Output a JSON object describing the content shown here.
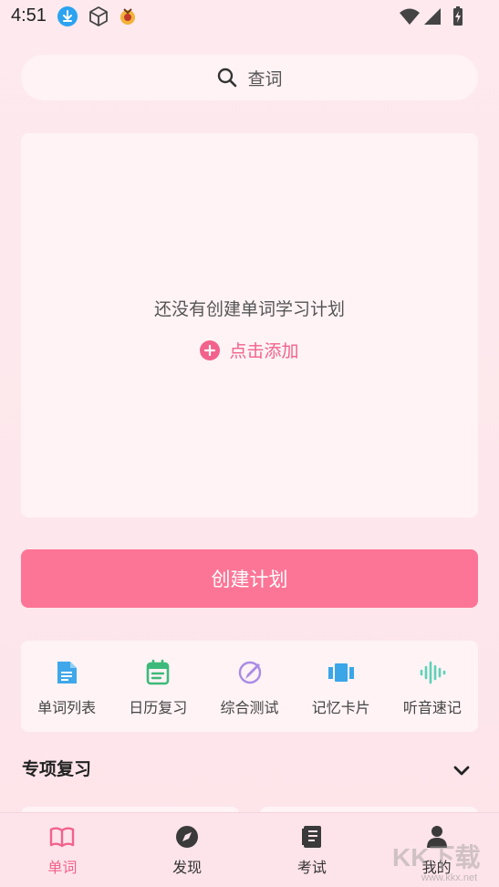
{
  "status_bar": {
    "time": "4:51",
    "icons": [
      "download-icon",
      "box-icon",
      "app-icon",
      "wifi-icon",
      "signal-icon",
      "battery-icon"
    ]
  },
  "search": {
    "placeholder": "查词",
    "icon": "search-icon"
  },
  "plan": {
    "empty_text": "还没有创建单词学习计划",
    "add_label": "点击添加",
    "add_icon": "plus-circle-icon"
  },
  "create_button": {
    "label": "创建计划"
  },
  "features": [
    {
      "label": "单词列表",
      "icon": "document-icon",
      "color": "#3fa7ea"
    },
    {
      "label": "日历复习",
      "icon": "calendar-icon",
      "color": "#3dba7a"
    },
    {
      "label": "综合测试",
      "icon": "test-icon",
      "color": "#a98be6"
    },
    {
      "label": "记忆卡片",
      "icon": "cards-icon",
      "color": "#3aa6e8"
    },
    {
      "label": "听音速记",
      "icon": "audio-wave-icon",
      "color": "#5ed1b8"
    }
  ],
  "special_review": {
    "title": "专项复习",
    "icon": "chevron-down-icon"
  },
  "nav": [
    {
      "label": "单词",
      "icon": "book-icon",
      "active": true
    },
    {
      "label": "发现",
      "icon": "compass-icon",
      "active": false
    },
    {
      "label": "考试",
      "icon": "exam-icon",
      "active": false
    },
    {
      "label": "我的",
      "icon": "user-icon",
      "active": false
    }
  ],
  "colors": {
    "accent": "#fd7596",
    "accent_text": "#f2628c",
    "background": "#fde9ee",
    "card": "#fff3f5"
  },
  "watermark": {
    "text": "KK下载",
    "url": "www.kkx.net"
  }
}
